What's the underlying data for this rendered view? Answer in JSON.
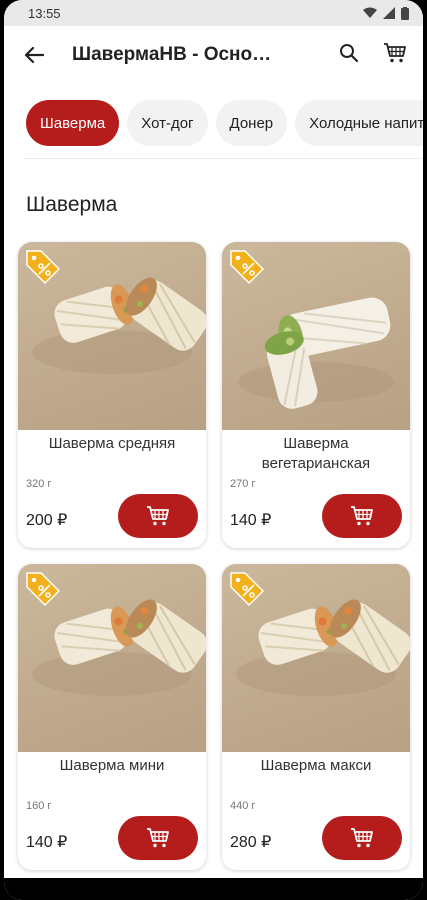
{
  "status": {
    "time": "13:55"
  },
  "appbar": {
    "title": "ШавермаНВ - Основное меню"
  },
  "chips": [
    "Шаверма",
    "Хот-дог",
    "Донер",
    "Холодные напитки"
  ],
  "section": {
    "title": "Шаверма"
  },
  "products": [
    {
      "name": "Шаверма средняя",
      "weight": "320 г",
      "price": "200 ₽",
      "variant": "meat"
    },
    {
      "name": "Шаверма вегетарианская",
      "weight": "270 г",
      "price": "140 ₽",
      "variant": "veg"
    },
    {
      "name": "Шаверма мини",
      "weight": "160 г",
      "price": "140 ₽",
      "variant": "meat"
    },
    {
      "name": "Шаверма макси",
      "weight": "440 г",
      "price": "280 ₽",
      "variant": "meat"
    }
  ],
  "colors": {
    "accent": "#b51c1c",
    "badge": "#f2b11c"
  }
}
